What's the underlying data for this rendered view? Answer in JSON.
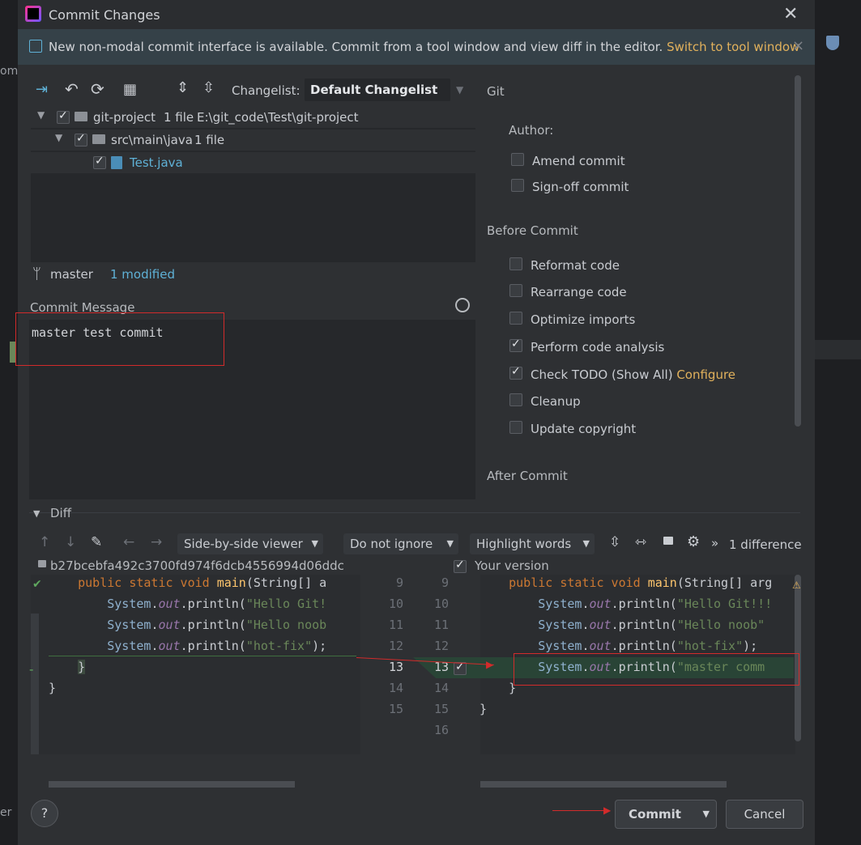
{
  "window": {
    "title": "Commit Changes",
    "close_icon": "close-icon"
  },
  "banner": {
    "text": "New non-modal commit interface is available. Commit from a tool window and view diff in the editor.",
    "link": "Switch to tool window",
    "close": "×"
  },
  "toolbar": {
    "changelist_label": "Changelist:",
    "changelist_value": "Default Changelist"
  },
  "tree": {
    "root": {
      "name": "git-project",
      "count": "1 file",
      "path": "E:\\git_code\\Test\\git-project"
    },
    "folder": {
      "name": "src\\main\\java",
      "count": "1 file"
    },
    "file": {
      "name": "Test.java"
    }
  },
  "status": {
    "branch": "master",
    "modified": "1 modified"
  },
  "commit_message": {
    "label": "Commit Message",
    "value": "master test commit"
  },
  "git": {
    "section": "Git",
    "author_label": "Author:",
    "amend": "Amend commit",
    "signoff": "Sign-off commit"
  },
  "before_commit": {
    "section": "Before Commit",
    "options": [
      {
        "label": "Reformat code",
        "checked": false
      },
      {
        "label": "Rearrange code",
        "checked": false
      },
      {
        "label": "Optimize imports",
        "checked": false
      },
      {
        "label": "Perform code analysis",
        "checked": true
      },
      {
        "label": "Check TODO (Show All)",
        "checked": true,
        "link": "Configure"
      },
      {
        "label": "Cleanup",
        "checked": false
      },
      {
        "label": "Update copyright",
        "checked": false
      }
    ]
  },
  "after_commit": {
    "section": "After Commit"
  },
  "diff": {
    "section": "Diff",
    "viewer": "Side-by-side viewer",
    "ignore": "Do not ignore",
    "highlight": "Highlight words",
    "more": "»",
    "differences": "1 difference",
    "left_header": "b27bcebfa492c3700fd974f6dcb4556994d06ddc",
    "right_header": "Your version",
    "left_lines": [
      {
        "num": "9",
        "code": "    public static void main(String[] a"
      },
      {
        "num": "10",
        "code": "        System.out.println(\"Hello Git!"
      },
      {
        "num": "11",
        "code": "        System.out.println(\"Hello noob"
      },
      {
        "num": "12",
        "code": "        System.out.println(\"hot-fix\");"
      },
      {
        "num": "13",
        "code": "    }"
      },
      {
        "num": "14",
        "code": "}"
      },
      {
        "num": "15",
        "code": ""
      }
    ],
    "right_lines": [
      {
        "num": "9",
        "code": "    public static void main(String[] arg"
      },
      {
        "num": "10",
        "code": "        System.out.println(\"Hello Git!!!"
      },
      {
        "num": "11",
        "code": "        System.out.println(\"Hello noob\""
      },
      {
        "num": "12",
        "code": "        System.out.println(\"hot-fix\");"
      },
      {
        "num": "13",
        "code": "        System.out.println(\"master comm"
      },
      {
        "num": "14",
        "code": "    }"
      },
      {
        "num": "15",
        "code": "}"
      },
      {
        "num": "16",
        "code": ""
      }
    ]
  },
  "footer": {
    "help": "?",
    "commit": "Commit",
    "cancel": "Cancel"
  },
  "edge": {
    "left1": "om",
    "left2": "er"
  }
}
